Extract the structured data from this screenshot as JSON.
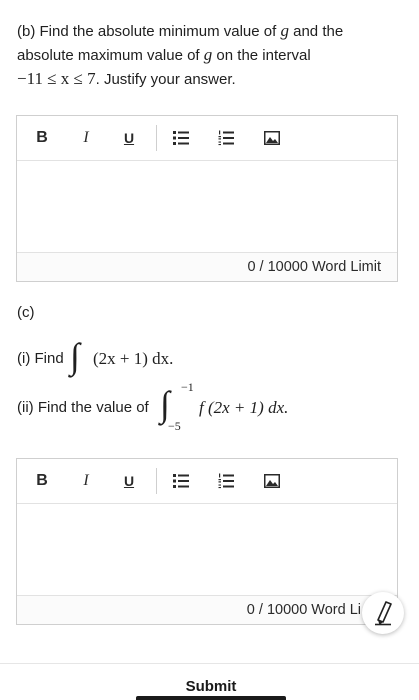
{
  "part_b": {
    "line1_prefix": "(b)  Find the absolute minimum value of ",
    "var_g": "g",
    "line1_mid": " and the",
    "line2_prefix": "absolute maximum value of ",
    "line2_suffix": " on the interval",
    "interval_math": "−11 ≤ x ≤ 7",
    "line3_suffix": ". Justify your answer."
  },
  "part_c": {
    "label": "(c)",
    "i_prefix": "(i) Find ",
    "i_integrand": "(2x + 1) dx.",
    "ii_prefix": "(ii) Find the value of ",
    "ii_upper": "−1",
    "ii_lower": "−5",
    "ii_integrand": "f (2x + 1) dx."
  },
  "editor": {
    "bold": "B",
    "italic": "I",
    "underline": "U",
    "word_count_1": "0 / 10000 Word Limit",
    "word_count_2": "0 / 10000 Word Li"
  },
  "icons": [
    "bulleted-list-icon",
    "numbered-list-icon",
    "image-icon",
    "pencil-icon"
  ],
  "footer": {
    "submit": "Submit"
  }
}
